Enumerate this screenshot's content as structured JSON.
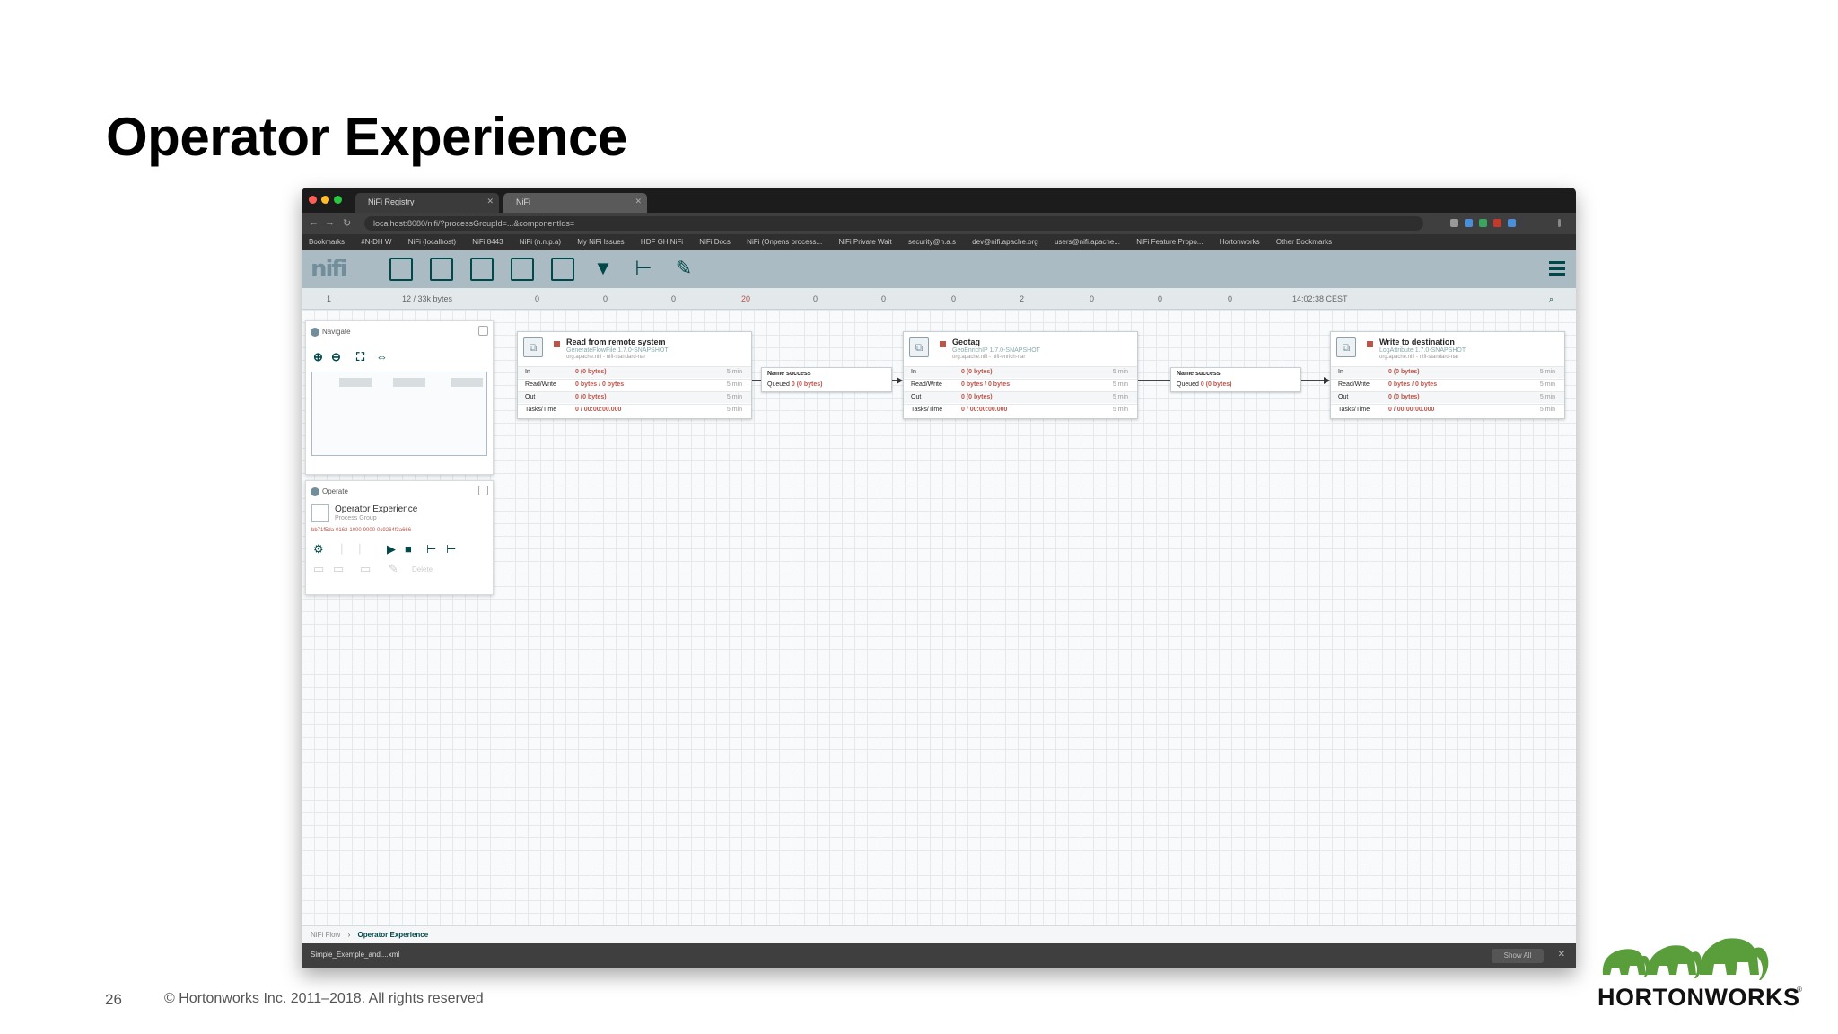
{
  "slide": {
    "title": "Operator Experience",
    "page_number": "26",
    "copyright": "© Hortonworks Inc. 2011–2018. All rights reserved",
    "logo_text": "HORTONWORKS",
    "logo_reg": "®"
  },
  "browser": {
    "tabs": [
      {
        "label": "NiFi Registry"
      },
      {
        "label": "NiFi"
      }
    ],
    "address": "localhost:8080/nifi/?processGroupId=...&componentIds=",
    "bookmarks": [
      "Bookmarks",
      "#N-DH W",
      "NiFi (localhost)",
      "NiFi 8443",
      "NiFi (n.n.p.a)",
      "My NiFi Issues",
      "HDF GH NiFi",
      "NiFi Docs",
      "NiFi (Onpens process...",
      "NiFi Private Wait",
      "security@n.a.s",
      "dev@nifi.apache.org",
      "users@nifi.apache...",
      "NiFi Feature Propo...",
      "Hortonworks",
      "Other Bookmarks"
    ]
  },
  "nifi": {
    "logo": "nifi",
    "status": {
      "active_threads": "1",
      "queued": "12 / 33k bytes",
      "transmitting": "0",
      "not_transmitting": "0",
      "running": "0",
      "stopped": "20",
      "invalid": "0",
      "disabled": "0",
      "up_to_date": "0",
      "locally_modified": "2",
      "stale": "0",
      "locally_modified_stale": "0",
      "sync_failure": "0",
      "last_refresh": "14:02:38 CEST"
    },
    "navigate": {
      "title": "Navigate"
    },
    "operate": {
      "title": "Operate",
      "group_name": "Operator Experience",
      "group_type": "Process Group",
      "group_id": "bb71f5da-0162-1000-9000-0c9264f3a666",
      "disable_label": "Delete"
    },
    "processors": [
      {
        "name": "Read from remote system",
        "type": "GenerateFlowFile 1.7.0-SNAPSHOT",
        "bundle": "org.apache.nifi - nifi-standard-nar",
        "rows": [
          {
            "label": "In",
            "value": "0 (0 bytes)",
            "time": "5 min"
          },
          {
            "label": "Read/Write",
            "value": "0 bytes / 0 bytes",
            "time": "5 min"
          },
          {
            "label": "Out",
            "value": "0 (0 bytes)",
            "time": "5 min"
          },
          {
            "label": "Tasks/Time",
            "value": "0 / 00:00:00.000",
            "time": "5 min"
          }
        ]
      },
      {
        "name": "Geotag",
        "type": "GeoEnrichIP 1.7.0-SNAPSHOT",
        "bundle": "org.apache.nifi - nifi-enrich-nar",
        "rows": [
          {
            "label": "In",
            "value": "0 (0 bytes)",
            "time": "5 min"
          },
          {
            "label": "Read/Write",
            "value": "0 bytes / 0 bytes",
            "time": "5 min"
          },
          {
            "label": "Out",
            "value": "0 (0 bytes)",
            "time": "5 min"
          },
          {
            "label": "Tasks/Time",
            "value": "0 / 00:00:00.000",
            "time": "5 min"
          }
        ]
      },
      {
        "name": "Write to destination",
        "type": "LogAttribute 1.7.0-SNAPSHOT",
        "bundle": "org.apache.nifi - nifi-standard-nar",
        "rows": [
          {
            "label": "In",
            "value": "0 (0 bytes)",
            "time": "5 min"
          },
          {
            "label": "Read/Write",
            "value": "0 bytes / 0 bytes",
            "time": "5 min"
          },
          {
            "label": "Out",
            "value": "0 (0 bytes)",
            "time": "5 min"
          },
          {
            "label": "Tasks/Time",
            "value": "0 / 00:00:00.000",
            "time": "5 min"
          }
        ]
      }
    ],
    "connections": [
      {
        "name": "Name  success",
        "queued_label": "Queued",
        "queued": "0 (0 bytes)"
      },
      {
        "name": "Name  success",
        "queued_label": "Queued",
        "queued": "0 (0 bytes)"
      }
    ],
    "breadcrumb": {
      "root": "NiFi Flow",
      "current": "Operator Experience"
    },
    "downloads": {
      "file": "Simple_Exemple_and....xml",
      "show_all": "Show All"
    }
  },
  "colors": {
    "toolbar": "#aabbc3",
    "accent": "#004849",
    "stopped": "#ba554a"
  }
}
